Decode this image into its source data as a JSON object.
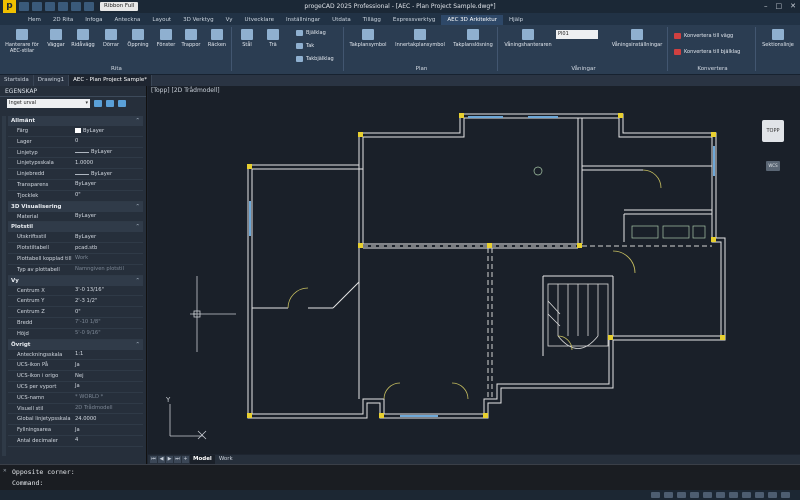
{
  "app": {
    "title": "progeCAD 2025 Professional - [AEC - Plan Project Sample.dwg*]",
    "ribbon_combo": "Ribbon Full",
    "logo": "p"
  },
  "menu_tabs": [
    "Hem",
    "2D Rita",
    "Infoga",
    "Anteckna",
    "Layout",
    "3D Verktyg",
    "Vy",
    "Utvecklare",
    "Inställningar",
    "Utdata",
    "Tillägg",
    "Expressverktyg",
    "AEC 3D Arkitektur",
    "Hjälp"
  ],
  "active_menu_tab": "AEC 3D Arkitektur",
  "ribbon": {
    "rita": {
      "name": "Rita",
      "buttons": [
        "Hanterare för AEC-stilar",
        "Väggar",
        "Ridåvägg",
        "Dörrar",
        "Öppning",
        "Fönster",
        "Trappor",
        "Räcken",
        "Stål",
        "Trä"
      ],
      "small": [
        "Bjälklag",
        "Tak",
        "Takbjälklag"
      ]
    },
    "plan": {
      "name": "Plan",
      "buttons": [
        "Takplansymbol",
        "Innertakplansymbol",
        "Takplanslösning"
      ]
    },
    "vaningar": {
      "name": "Våningar",
      "buttons": [
        "Våningshanteraren",
        "Våningsinställningar"
      ],
      "combo_value": "Pl01"
    },
    "konvertera": {
      "name": "Konvertera",
      "items": [
        "Konvertera till vägg",
        "Konvertera till bjälklag"
      ]
    },
    "extra": {
      "buttons": [
        "Sektionslinje"
      ]
    }
  },
  "doc_tabs": [
    "Startsida",
    "Drawing1",
    "AEC - Plan Project Sample*"
  ],
  "active_doc_tab": "AEC - Plan Project Sample*",
  "properties": {
    "title": "EGENSKAP",
    "selection": "Inget urval",
    "sections": [
      {
        "name": "Allmänt",
        "rows": [
          {
            "k": "Färg",
            "v": "ByLayer",
            "swatch": true
          },
          {
            "k": "Lager",
            "v": "0"
          },
          {
            "k": "Linjetyp",
            "v": "ByLayer",
            "line": true
          },
          {
            "k": "Linjetypsskala",
            "v": "1.0000"
          },
          {
            "k": "Linjebredd",
            "v": "ByLayer",
            "line": true
          },
          {
            "k": "Transparens",
            "v": "ByLayer"
          },
          {
            "k": "Tjocklek",
            "v": "0\""
          }
        ]
      },
      {
        "name": "3D Visualisering",
        "rows": [
          {
            "k": "Material",
            "v": "ByLayer"
          }
        ]
      },
      {
        "name": "Plotstil",
        "rows": [
          {
            "k": "Utskriftsstil",
            "v": "ByLayer"
          },
          {
            "k": "Plotstiltabell",
            "v": "pcad.stb"
          },
          {
            "k": "Plottabell kopplad till",
            "v": "Work",
            "dim": true
          },
          {
            "k": "Typ av plottabell",
            "v": "Namngiven plotstil",
            "dim": true
          }
        ]
      },
      {
        "name": "Vy",
        "rows": [
          {
            "k": "Centrum X",
            "v": "3'-0 13/16\""
          },
          {
            "k": "Centrum Y",
            "v": "2'-3 1/2\""
          },
          {
            "k": "Centrum Z",
            "v": "0\""
          },
          {
            "k": "Bredd",
            "v": "7'-10 1/8\"",
            "dim": true
          },
          {
            "k": "Höjd",
            "v": "5'-0 9/16\"",
            "dim": true
          }
        ]
      },
      {
        "name": "Övrigt",
        "rows": [
          {
            "k": "Anteckningsskala",
            "v": "1:1"
          },
          {
            "k": "UCS-ikon På",
            "v": "Ja"
          },
          {
            "k": "UCS-ikon i origo",
            "v": "Nej"
          },
          {
            "k": "UCS per vyport",
            "v": "Ja"
          },
          {
            "k": "UCS-namn",
            "v": "* WORLD *",
            "dim": true
          },
          {
            "k": "Visuell stil",
            "v": "2D Trådmodell",
            "dim": true
          },
          {
            "k": "Global linjetypsskala",
            "v": "24.0000"
          },
          {
            "k": "Fyllningsarea",
            "v": "Ja"
          },
          {
            "k": "Antal decimaler",
            "v": "4"
          }
        ]
      }
    ]
  },
  "viewport": {
    "label": "[Topp] [2D Trådmodell]",
    "viewcube": "TOPP",
    "wcs": "WCS",
    "ucs_y": "Y",
    "ucs_x": "X"
  },
  "model_tabs": [
    "Model",
    "Work"
  ],
  "active_model_tab": "Model",
  "command_line": {
    "line1": "Opposite corner:",
    "line2": "Command:"
  },
  "colors": {
    "wall": "#e8e8e8",
    "accent": "#f0c000",
    "window": "#6ea8d8",
    "door": "#c8c060"
  }
}
